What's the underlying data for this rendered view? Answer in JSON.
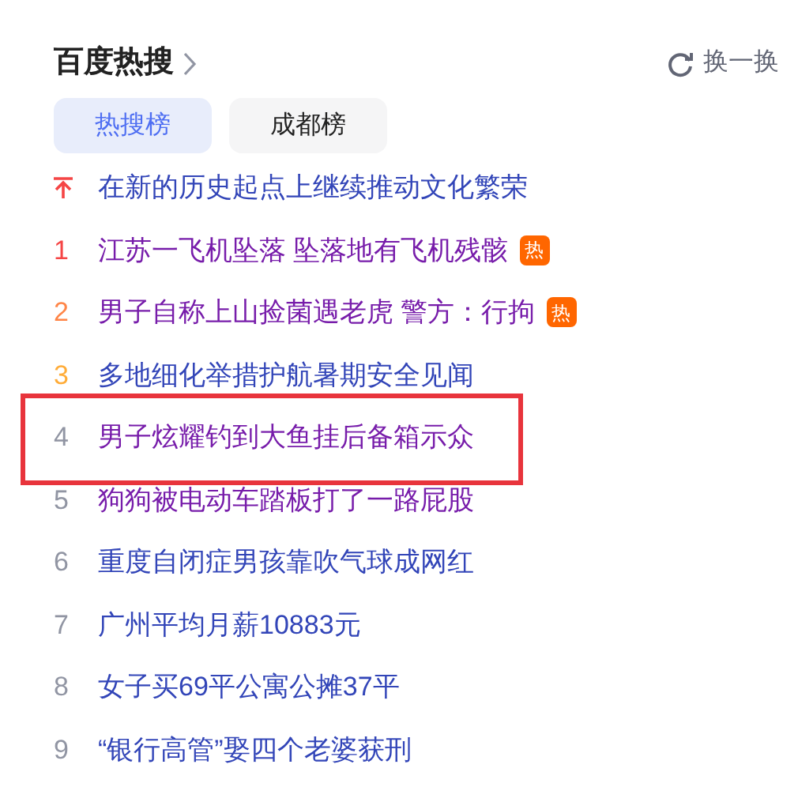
{
  "header": {
    "title": "百度热搜",
    "refresh_label": "换一换"
  },
  "tabs": [
    {
      "label": "热搜榜",
      "selected": true
    },
    {
      "label": "成都榜",
      "selected": false
    }
  ],
  "items": [
    {
      "kind": "pinned",
      "text": "在新的历史起点上继续推动文化繁荣",
      "visited": false,
      "highlighted": false
    },
    {
      "kind": "ranked",
      "rank": "1",
      "text": "江苏一飞机坠落 坠落地有飞机残骸",
      "badge": "热",
      "visited": true,
      "highlighted": false
    },
    {
      "kind": "ranked",
      "rank": "2",
      "text": "男子自称上山捡菌遇老虎 警方：行拘",
      "badge": "热",
      "visited": true,
      "highlighted": false
    },
    {
      "kind": "ranked",
      "rank": "3",
      "text": "多地细化举措护航暑期安全见闻",
      "visited": false,
      "highlighted": false
    },
    {
      "kind": "ranked",
      "rank": "4",
      "text": "男子炫耀钓到大鱼挂后备箱示众",
      "visited": true,
      "highlighted": true
    },
    {
      "kind": "ranked",
      "rank": "5",
      "text": "狗狗被电动车踏板打了一路屁股",
      "visited": true,
      "highlighted": false
    },
    {
      "kind": "ranked",
      "rank": "6",
      "text": "重度自闭症男孩靠吹气球成网红",
      "visited": false,
      "highlighted": false
    },
    {
      "kind": "ranked",
      "rank": "7",
      "text": "广州平均月薪10883元",
      "visited": false,
      "highlighted": false
    },
    {
      "kind": "ranked",
      "rank": "8",
      "text": "女子买69平公寓公摊37平",
      "visited": false,
      "highlighted": false
    },
    {
      "kind": "ranked",
      "rank": "9",
      "text": "“银行高管”娶四个老婆获刑",
      "visited": false,
      "highlighted": false
    }
  ]
}
